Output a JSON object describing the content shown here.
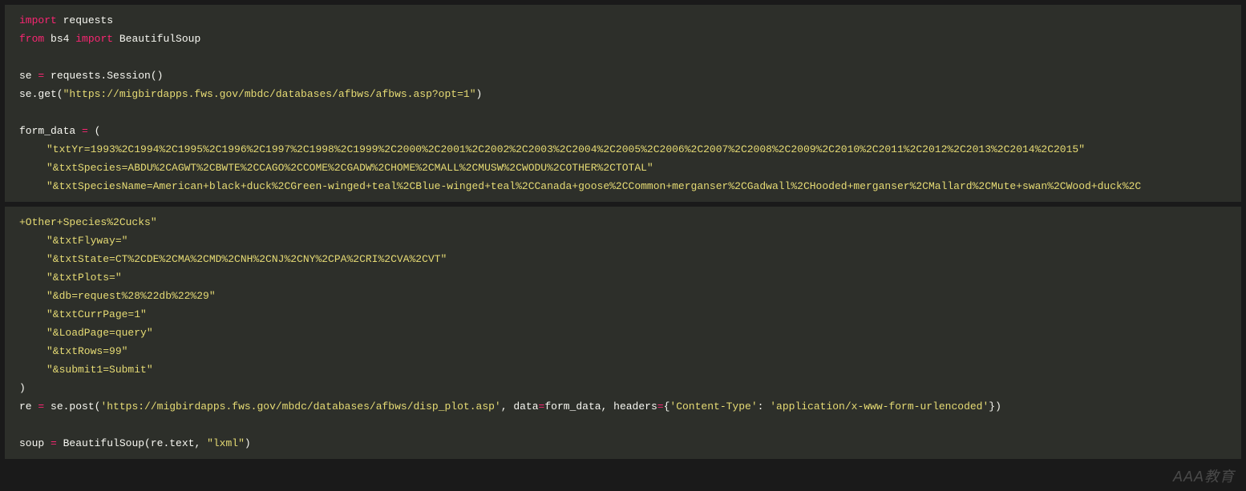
{
  "block1": {
    "l1_kw": "import",
    "l1_mod": " requests",
    "l2_from": "from",
    "l2_mod": " bs4 ",
    "l2_imp": "import",
    "l2_obj": " BeautifulSoup",
    "l3_pl": "se ",
    "l3_op": "=",
    "l3_rest": " requests.Session()",
    "l4_pre": "se.get(",
    "l4_str": "\"https://migbirdapps.fws.gov/mbdc/databases/afbws/afbws.asp?opt=1\"",
    "l4_post": ")",
    "l5_pl": "form_data ",
    "l5_op": "=",
    "l5_rest": " (",
    "l6_str": "\"txtYr=1993%2C1994%2C1995%2C1996%2C1997%2C1998%2C1999%2C2000%2C2001%2C2002%2C2003%2C2004%2C2005%2C2006%2C2007%2C2008%2C2009%2C2010%2C2011%2C2012%2C2013%2C2014%2C2015\"",
    "l7_str": "\"&txtSpecies=ABDU%2CAGWT%2CBWTE%2CCAGO%2CCOME%2CGADW%2CHOME%2CMALL%2CMUSW%2CWODU%2COTHER%2CTOTAL\"",
    "l8_str": "\"&txtSpeciesName=American+black+duck%2CGreen-winged+teal%2CBlue-winged+teal%2CCanada+goose%2CCommon+merganser%2CGadwall%2CHooded+merganser%2CMallard%2CMute+swan%2CWood+duck%2C"
  },
  "block2": {
    "l1_str": "+Other+Species%2Cucks\"",
    "l2_str": "\"&txtFlyway=\"",
    "l3_str": "\"&txtState=CT%2CDE%2CMA%2CMD%2CNH%2CNJ%2CNY%2CPA%2CRI%2CVA%2CVT\"",
    "l4_str": "\"&txtPlots=\"",
    "l5_str": "\"&db=request%28%22db%22%29\"",
    "l6_str": "\"&txtCurrPage=1\"",
    "l7_str": "\"&LoadPage=query\"",
    "l8_str": "\"&txtRows=99\"",
    "l9_str": "\"&submit1=Submit\"",
    "l10_pl": ")",
    "l11_pre": "re ",
    "l11_op": "=",
    "l11_mid": " se.post(",
    "l11_url": "'https://migbirdapps.fws.gov/mbdc/databases/afbws/disp_plot.asp'",
    "l11_pd": ", data",
    "l11_op2": "=",
    "l11_fd": "form_data, headers",
    "l11_op3": "=",
    "l11_br": "{",
    "l11_ct": "'Content-Type'",
    "l11_col": ": ",
    "l11_ctv": "'application/x-www-form-urlencoded'",
    "l11_end": "})",
    "l12_pre": "soup ",
    "l12_op": "=",
    "l12_mid": " BeautifulSoup(re.text, ",
    "l12_lxml": "\"lxml\"",
    "l12_end": ")"
  },
  "watermark": "AAA教育"
}
